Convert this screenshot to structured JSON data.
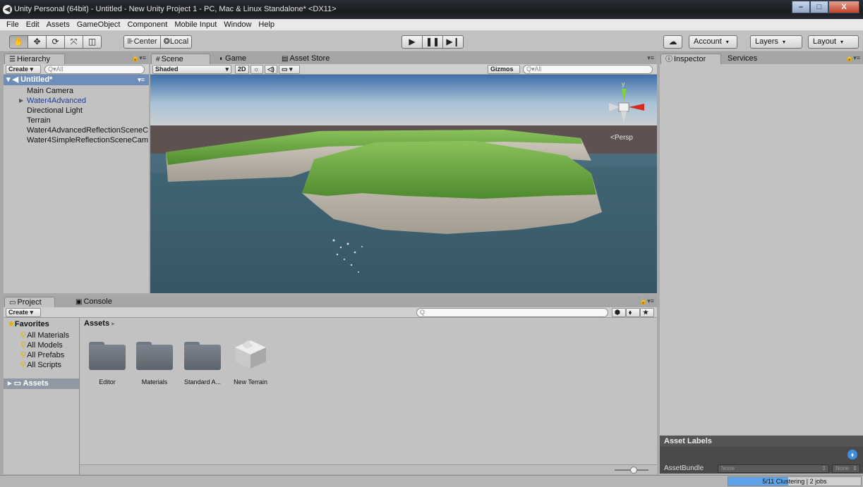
{
  "window": {
    "title": "Unity Personal (64bit) - Untitled - New Unity Project 1 - PC, Mac & Linux Standalone* <DX11>",
    "controls": {
      "minimize": "–",
      "maximize": "□",
      "close": "X"
    }
  },
  "menu": [
    "File",
    "Edit",
    "Assets",
    "GameObject",
    "Component",
    "Mobile Input",
    "Window",
    "Help"
  ],
  "toolbar": {
    "transform_tools": [
      "hand-tool",
      "move-tool",
      "rotate-tool",
      "scale-tool",
      "rect-tool"
    ],
    "pivot": "Center",
    "space": "Local",
    "account": "Account",
    "layers": "Layers",
    "layout": "Layout"
  },
  "hierarchy": {
    "tab": "Hierarchy",
    "create": "Create",
    "search_placeholder": "All",
    "scene_name": "Untitled*",
    "items": [
      {
        "label": "Main Camera",
        "prefab": false,
        "expandable": false
      },
      {
        "label": "Water4Advanced",
        "prefab": true,
        "expandable": true
      },
      {
        "label": "Directional Light",
        "prefab": false,
        "expandable": false
      },
      {
        "label": "Terrain",
        "prefab": false,
        "expandable": false
      },
      {
        "label": "Water4AdvancedReflectionSceneC",
        "prefab": false,
        "expandable": false
      },
      {
        "label": "Water4SimpleReflectionSceneCam",
        "prefab": false,
        "expandable": false
      }
    ]
  },
  "scene_tabs": {
    "scene": "Scene",
    "game": "Game",
    "asset_store": "Asset Store"
  },
  "scene_bar": {
    "shading": "Shaded",
    "mode_2d": "2D",
    "gizmos": "Gizmos",
    "search_placeholder": "All"
  },
  "gizmo": {
    "projection": "Persp",
    "axis_y": "y"
  },
  "project": {
    "tab": "Project",
    "console_tab": "Console",
    "create": "Create",
    "favorites_label": "Favorites",
    "favorites": [
      "All Materials",
      "All Models",
      "All Prefabs",
      "All Scripts"
    ],
    "assets_root": "Assets",
    "breadcrumb": "Assets",
    "search_placeholder": "Q",
    "assets": [
      {
        "label": "Editor",
        "kind": "folder"
      },
      {
        "label": "Materials",
        "kind": "folder"
      },
      {
        "label": "Standard A...",
        "kind": "folder"
      },
      {
        "label": "New Terrain",
        "kind": "terrain"
      }
    ]
  },
  "inspector": {
    "tab": "Inspector",
    "services_tab": "Services",
    "asset_labels": "Asset Labels",
    "assetbundle_label": "AssetBundle",
    "assetbundle_value": "None",
    "assetbundle_variant": "None"
  },
  "status": {
    "text": "5/11 Clustering | 2 jobs",
    "progress": 0.45
  }
}
